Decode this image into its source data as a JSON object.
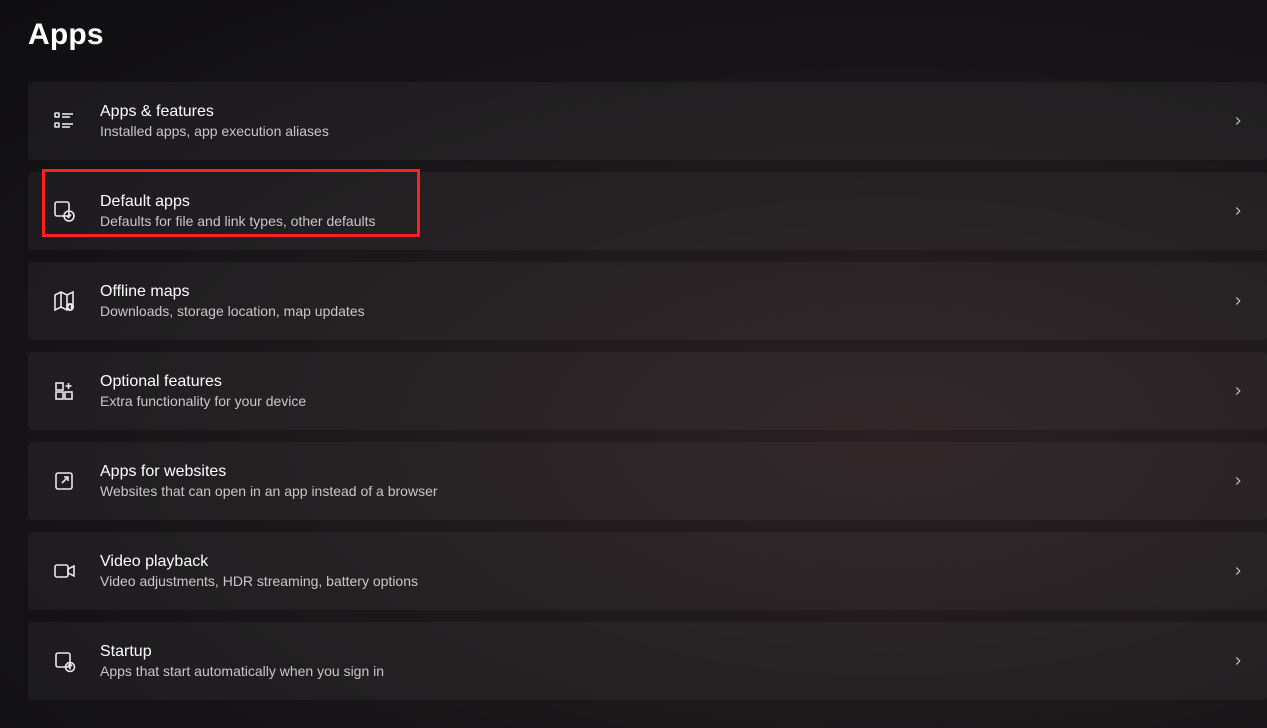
{
  "page": {
    "title": "Apps"
  },
  "items": [
    {
      "title": "Apps & features",
      "desc": "Installed apps, app execution aliases"
    },
    {
      "title": "Default apps",
      "desc": "Defaults for file and link types, other defaults"
    },
    {
      "title": "Offline maps",
      "desc": "Downloads, storage location, map updates"
    },
    {
      "title": "Optional features",
      "desc": "Extra functionality for your device"
    },
    {
      "title": "Apps for websites",
      "desc": "Websites that can open in an app instead of a browser"
    },
    {
      "title": "Video playback",
      "desc": "Video adjustments, HDR streaming, battery options"
    },
    {
      "title": "Startup",
      "desc": "Apps that start automatically when you sign in"
    }
  ],
  "highlight_index": 1
}
